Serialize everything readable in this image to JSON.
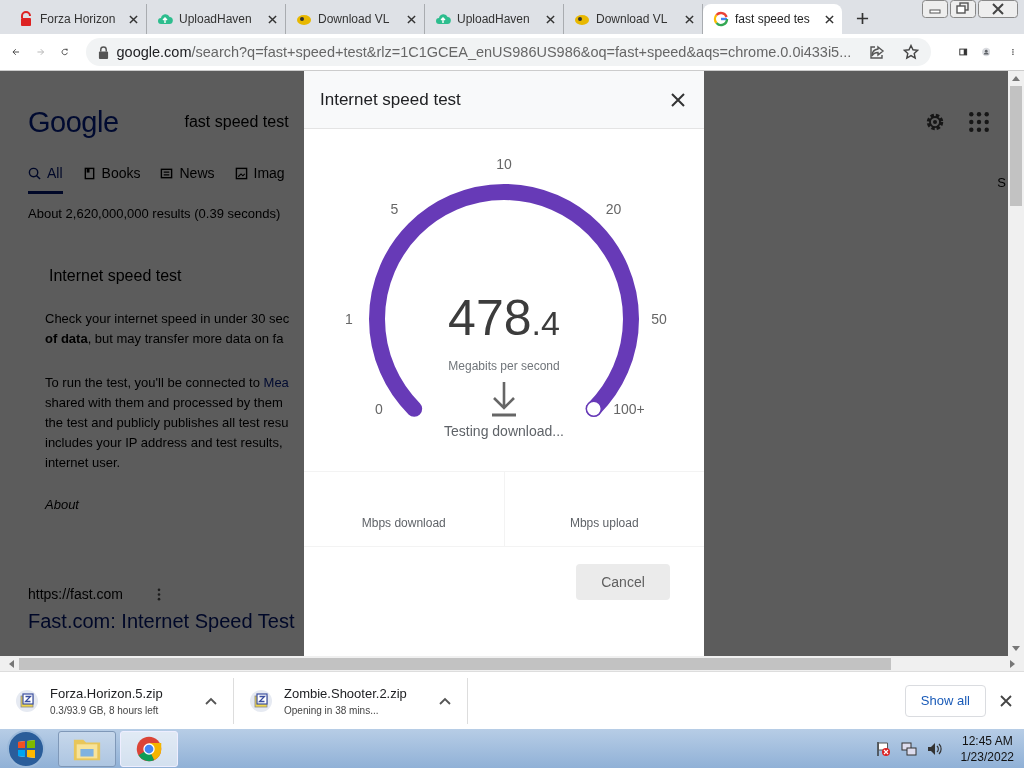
{
  "browser": {
    "tabs": [
      {
        "title": "Forza Horizon",
        "kind": "padlock",
        "selected": false
      },
      {
        "title": "UploadHaven",
        "kind": "cloud",
        "selected": false
      },
      {
        "title": "Download VL",
        "kind": "coin",
        "selected": false
      },
      {
        "title": "UploadHaven",
        "kind": "cloud",
        "selected": false
      },
      {
        "title": "Download VL",
        "kind": "coin",
        "selected": false
      },
      {
        "title": "fast speed tes",
        "kind": "google",
        "selected": true
      }
    ],
    "nav": [
      {
        "kind": "back",
        "disabled": false
      },
      {
        "kind": "forward",
        "disabled": true
      },
      {
        "kind": "reload",
        "disabled": false
      }
    ],
    "url_host": "google.com",
    "url_path": "/search?q=fast+speed+test&rlz=1C1GCEA_enUS986US986&oq=fast+speed&aqs=chrome.0.0i433i5..."
  },
  "page": {
    "logo": "Google",
    "query": "fast speed test",
    "nav": [
      {
        "label": "All",
        "kind": "search",
        "selected": true
      },
      {
        "label": "Books",
        "kind": "book",
        "selected": false
      },
      {
        "label": "News",
        "kind": "news",
        "selected": false
      },
      {
        "label": "Imag",
        "kind": "image",
        "selected": false
      }
    ],
    "result_stats": "About 2,620,000,000 results (0.39 seconds)",
    "card_title": "Internet speed test",
    "para1": [
      "Check your internet speed in under 30 sec",
      "**of data**, but may transfer more data on fa"
    ],
    "para2": [
      {
        "text": "To run the test, you'll be connected to ",
        "link": "Mea"
      },
      {
        "text": "shared with them and processed by them"
      },
      {
        "text": "the test and publicly publishes all test resu"
      },
      {
        "text": "includes your IP address and test results,"
      },
      {
        "text": "internet user."
      }
    ],
    "about": "About",
    "result_url": "https://fast.com",
    "result_title": "Fast.com: Internet Speed Test",
    "right_edge_text": "S"
  },
  "modal": {
    "title": "Internet speed test",
    "gauge": {
      "level": 1,
      "ticks": [
        "0",
        "1",
        "5",
        "10",
        "20",
        "50",
        "100+"
      ],
      "value": "478",
      "decimal": ".4",
      "unit": "Megabits per second",
      "status": "Testing download..."
    },
    "stats": [
      {
        "label": "Mbps download"
      },
      {
        "label": "Mbps upload"
      }
    ],
    "cancel": "Cancel"
  },
  "downloads": {
    "items": [
      {
        "name": "Forza.Horizon.5.zip",
        "status": "0.3/93.9 GB, 8 hours left"
      },
      {
        "name": "Zombie.Shooter.2.zip",
        "status": "Opening in 38 mins..."
      }
    ],
    "show_all": "Show all"
  },
  "taskbar": {
    "apps": [
      {
        "kind": "explorer",
        "selected": false
      },
      {
        "kind": "chrome",
        "selected": true
      }
    ],
    "time": "12:45 AM",
    "date": "1/23/2022"
  }
}
